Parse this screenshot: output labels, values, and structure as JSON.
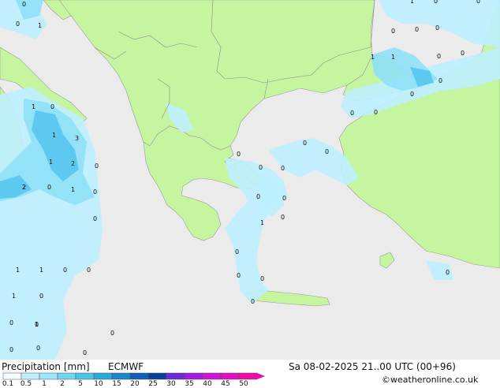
{
  "title": "Precipitation [mm]",
  "model": "ECMWF",
  "valid_time": "Sa 08-02-2025 21..00 UTC (00+96)",
  "credit": "©weatheronline.co.uk",
  "legend": {
    "ticks": [
      "0.1",
      "0.5",
      "1",
      "2",
      "5",
      "10",
      "15",
      "20",
      "25",
      "30",
      "35",
      "40",
      "45",
      "50"
    ],
    "colors": [
      "#f5fbff",
      "#bdf0ff",
      "#9ae6fa",
      "#71d5f0",
      "#4cc3e8",
      "#2aa8dd",
      "#1a86cc",
      "#0d62b8",
      "#0a3d99",
      "#6a2bd6",
      "#a21de0",
      "#d113d8",
      "#e010c0",
      "#f00aa8"
    ]
  },
  "map_colors": {
    "sea": "#ebebeb",
    "land": "#c6f5a0",
    "precip_light": "#bdf0ff",
    "precip_mid": "#8fe0f7",
    "precip_heavy": "#56c7ee"
  },
  "precip_values": [
    "0",
    "1",
    "0",
    "1",
    "0",
    "1",
    "1",
    "2",
    "0",
    "3",
    "1",
    "2",
    "0",
    "2",
    "0",
    "1",
    "1",
    "0",
    "1",
    "0",
    "0",
    "0",
    "0",
    "0",
    "0",
    "0",
    "0",
    "1",
    "0",
    "1",
    "0",
    "0",
    "0",
    "0",
    "0",
    "0",
    "0",
    "0",
    "0",
    "0",
    "0",
    "0",
    "0",
    "1",
    "1",
    "1",
    "0",
    "0",
    "0",
    "0",
    "0",
    "0",
    "0",
    "0",
    "0",
    "0",
    "0"
  ]
}
